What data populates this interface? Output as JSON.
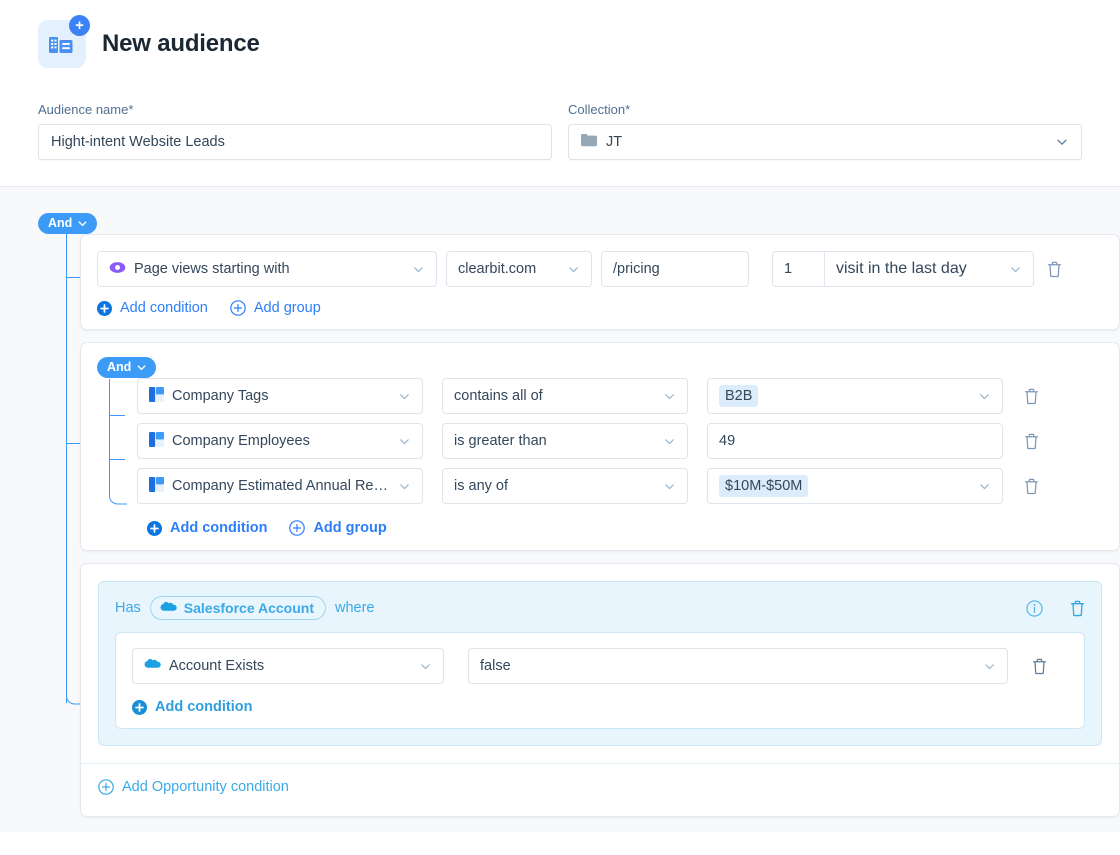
{
  "header": {
    "title": "New audience",
    "icon": "new-audience-icon",
    "badge_icon": "plus-badge-icon"
  },
  "form": {
    "audience_name": {
      "label": "Audience name*",
      "value": "Hight-intent Website Leads",
      "placeholder": "Audience name"
    },
    "collection": {
      "label": "Collection*",
      "value": "JT",
      "icon": "folder-icon",
      "chevron": "chevron-down-icon"
    }
  },
  "builder": {
    "root_operator": "And",
    "group1": {
      "condition": {
        "field": "Page views starting with",
        "field_icon": "eye-icon",
        "domain": "clearbit.com",
        "path": "/pricing",
        "count": "1",
        "frequency": "visit in the last day"
      },
      "add_condition": "Add condition",
      "add_group": "Add group"
    },
    "group2": {
      "operator": "And",
      "rows": [
        {
          "field": "Company Tags",
          "field_icon": "clearbit-icon",
          "operator": "contains all of",
          "value": "B2B",
          "value_is_chip": true
        },
        {
          "field": "Company Employees",
          "field_icon": "clearbit-icon",
          "operator": "is greater than",
          "value": "49",
          "value_is_chip": false
        },
        {
          "field": "Company Estimated Annual Revenue",
          "field_icon": "clearbit-icon",
          "operator": "is any of",
          "value": "$10M-$50M",
          "value_is_chip": true
        }
      ],
      "add_condition": "Add condition",
      "add_group": "Add group"
    },
    "group3": {
      "has_label": "Has",
      "object_chip": "Salesforce Account",
      "object_icon": "salesforce-cloud-icon",
      "where_label": "where",
      "info_icon": "info-icon",
      "delete_icon": "trash-icon",
      "condition": {
        "field": "Account Exists",
        "field_icon": "salesforce-cloud-icon",
        "value": "false"
      },
      "add_condition": "Add condition",
      "add_opportunity": "Add Opportunity condition"
    }
  },
  "colors": {
    "accent_blue": "#2d7ff9",
    "pill_blue": "#3d9bf8",
    "salesforce_blue": "#3aa9e8",
    "eye_purple": "#8a5cf6",
    "canvas": "#f7f9fb"
  }
}
